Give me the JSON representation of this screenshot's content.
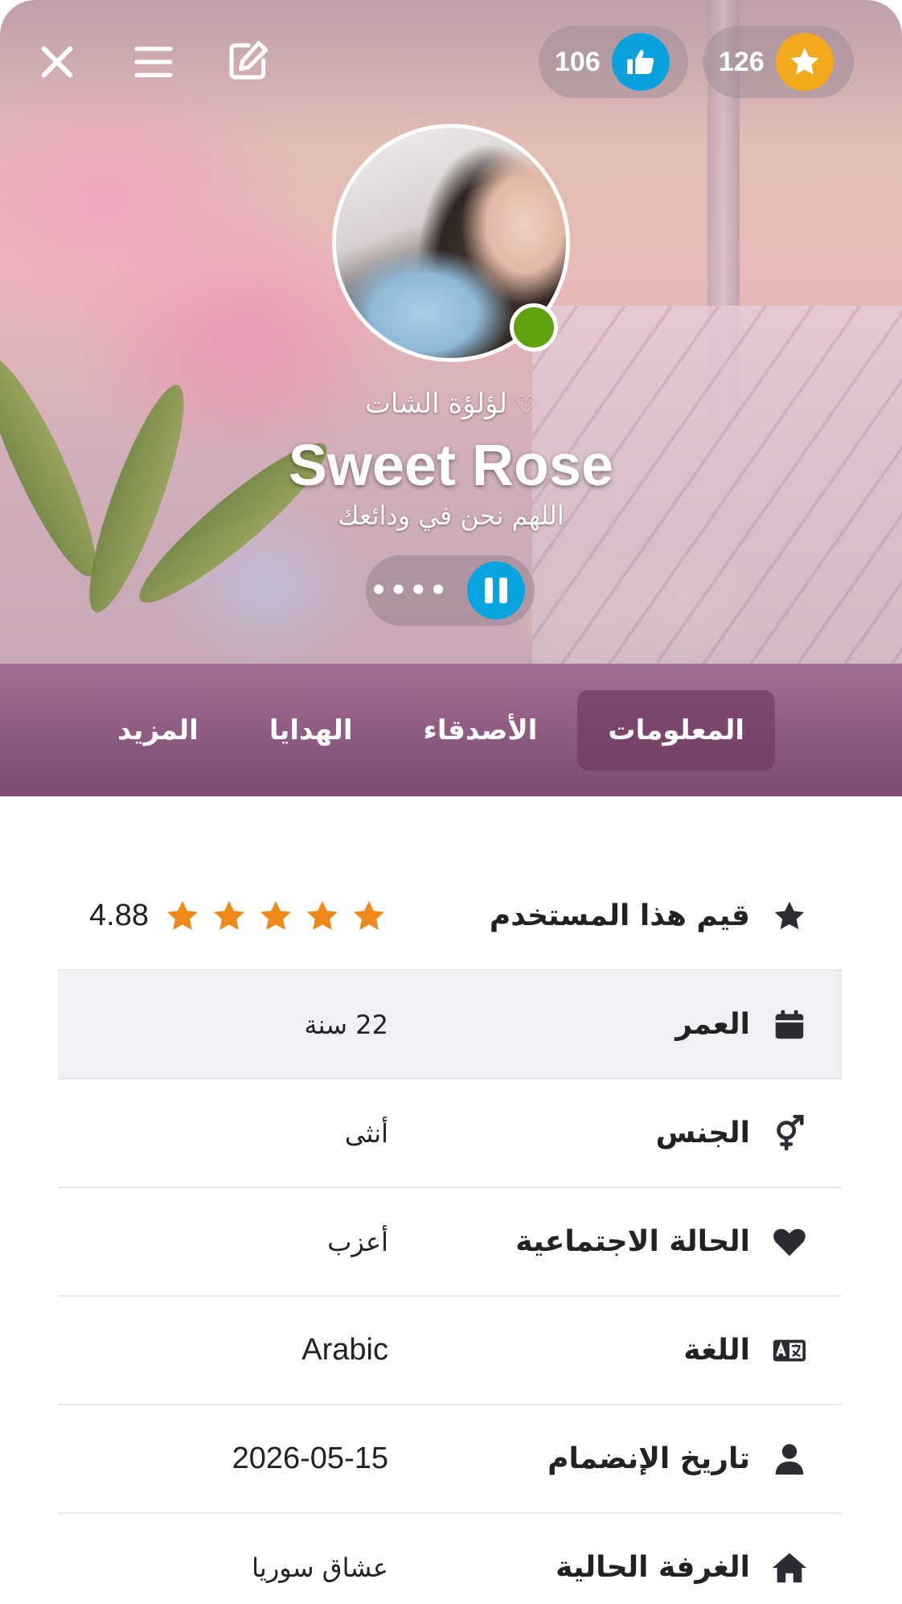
{
  "header": {
    "likes_count": "106",
    "stars_count": "126",
    "nickname": "لؤلؤة الشات",
    "nickname_heart": "♡",
    "username": "Sweet Rose",
    "status": "اللهم نحن في ودائعك",
    "player_dots": "••••"
  },
  "tabs": [
    {
      "label": "المعلومات",
      "active": true
    },
    {
      "label": "الأصدقاء",
      "active": false
    },
    {
      "label": "الهدايا",
      "active": false
    },
    {
      "label": "المزيد",
      "active": false
    }
  ],
  "info": {
    "rate": {
      "label": "قيم هذا المستخدم",
      "value": "4.88",
      "stars": 5
    },
    "age": {
      "label": "العمر",
      "value": "22 سنة"
    },
    "gender": {
      "label": "الجنس",
      "value": "أنثى"
    },
    "relationship": {
      "label": "الحالة الاجتماعية",
      "value": "أعزب"
    },
    "language": {
      "label": "اللغة",
      "value": "Arabic"
    },
    "join_date": {
      "label": "تاريخ الإنضمام",
      "value": "2026-05-15"
    },
    "current_room": {
      "label": "الغرفة الحالية",
      "value": "عشاق سوريا"
    }
  },
  "colors": {
    "tab_bar": "#8e5b80",
    "like_accent": "#0aa2de",
    "star_accent": "#f3a91c",
    "rating_star": "#ef8a1a",
    "online": "#5fa30f"
  },
  "icons": [
    "close-icon",
    "menu-icon",
    "edit-icon",
    "thumbs-up-icon",
    "star-icon",
    "pause-icon",
    "calendar-icon",
    "gender-icon",
    "heart-icon",
    "language-icon",
    "user-icon",
    "home-icon"
  ]
}
